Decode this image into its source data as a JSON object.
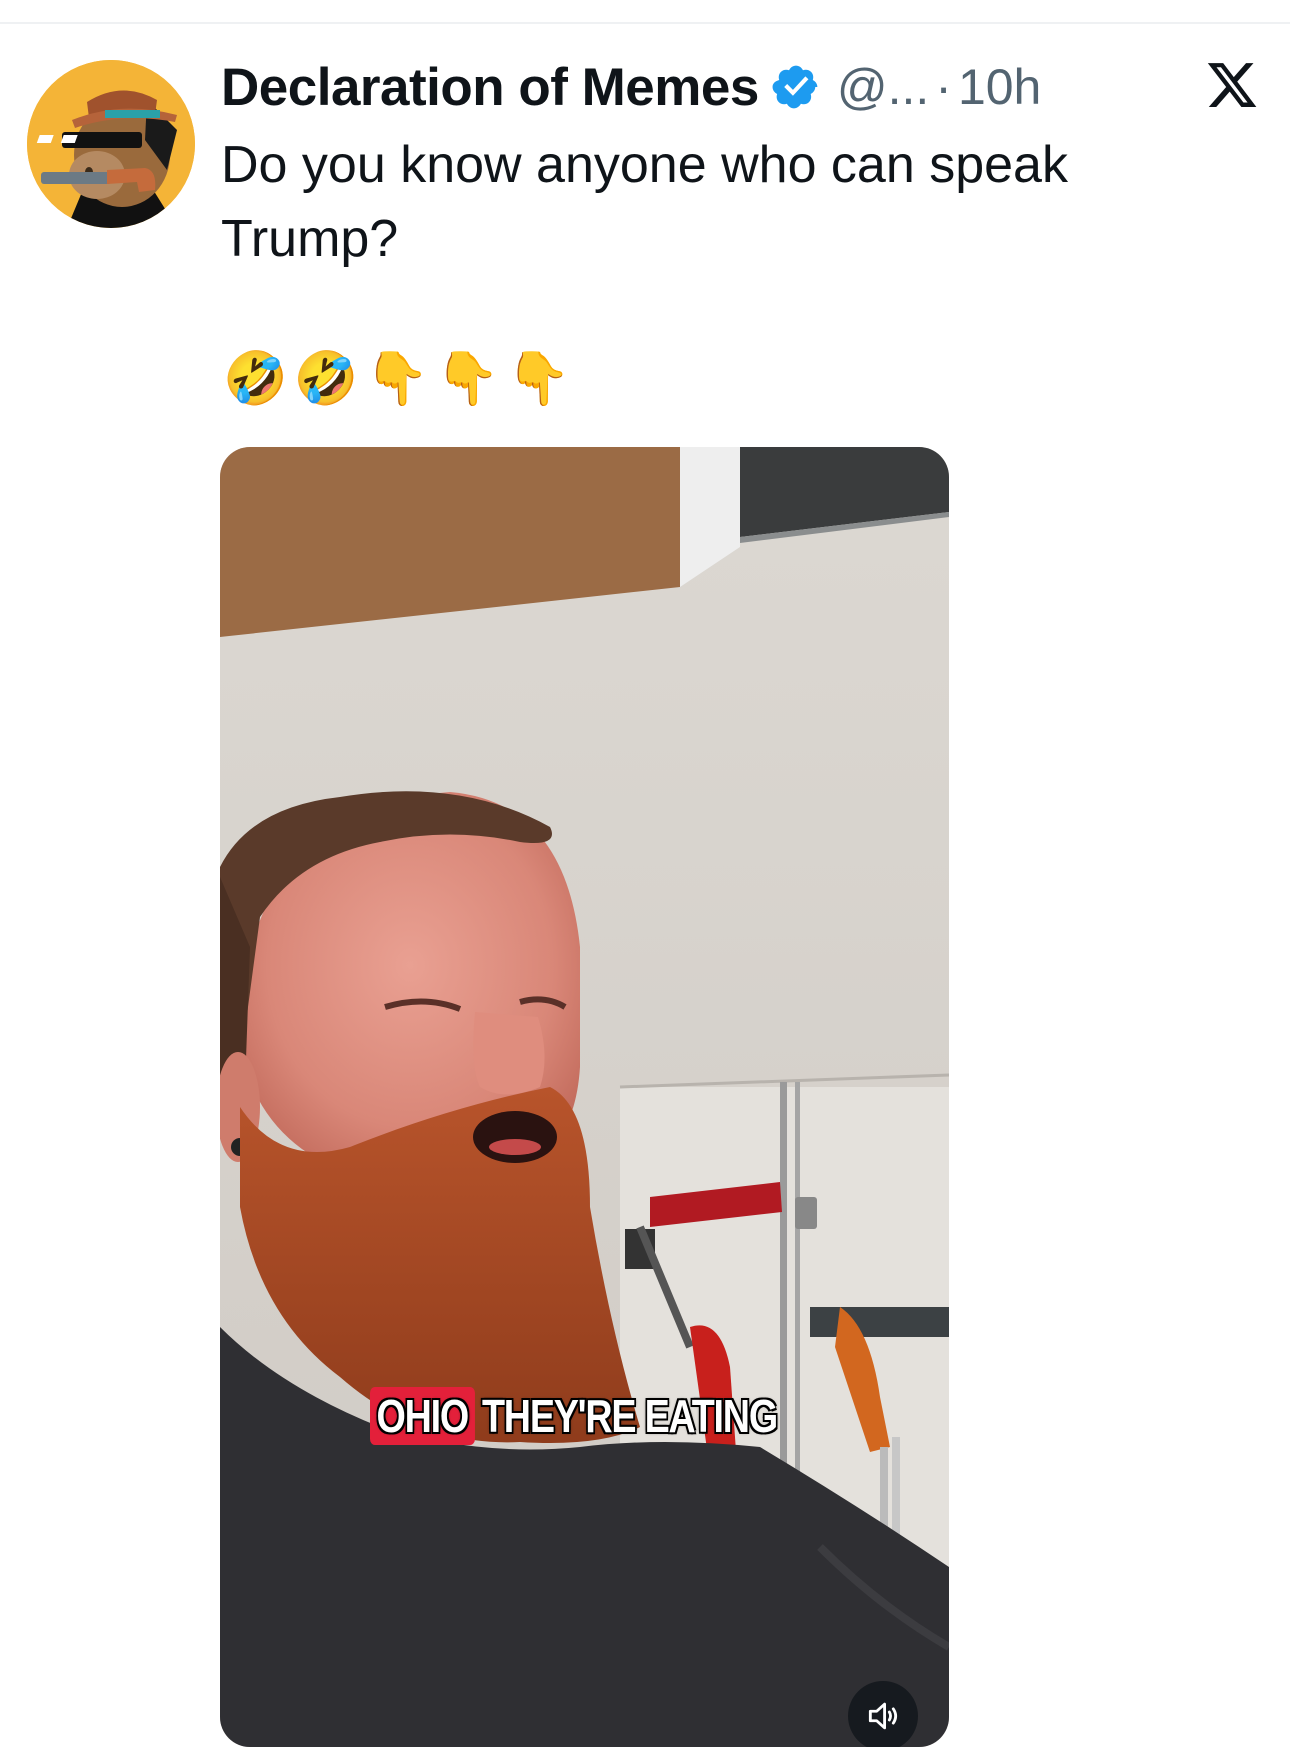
{
  "tweet": {
    "display_name": "Declaration of Memes",
    "handle": "@...",
    "separator": "·",
    "time": "10h",
    "verified": true,
    "text": "Do you know anyone who can speak Trump?",
    "emojis": "🤣🤣👇👇👇"
  },
  "media": {
    "type": "video",
    "caption_highlight": "OHIO",
    "caption_rest": "THEY'RE EATING",
    "caption_highlight_color": "#e3203a"
  },
  "icons": {
    "verified": "verified-badge-icon",
    "platform": "x-logo-icon",
    "mute": "volume-muted-icon"
  },
  "colors": {
    "verified_blue": "#1d9bf0",
    "secondary_text": "#536471",
    "primary_text": "#0f1419"
  }
}
